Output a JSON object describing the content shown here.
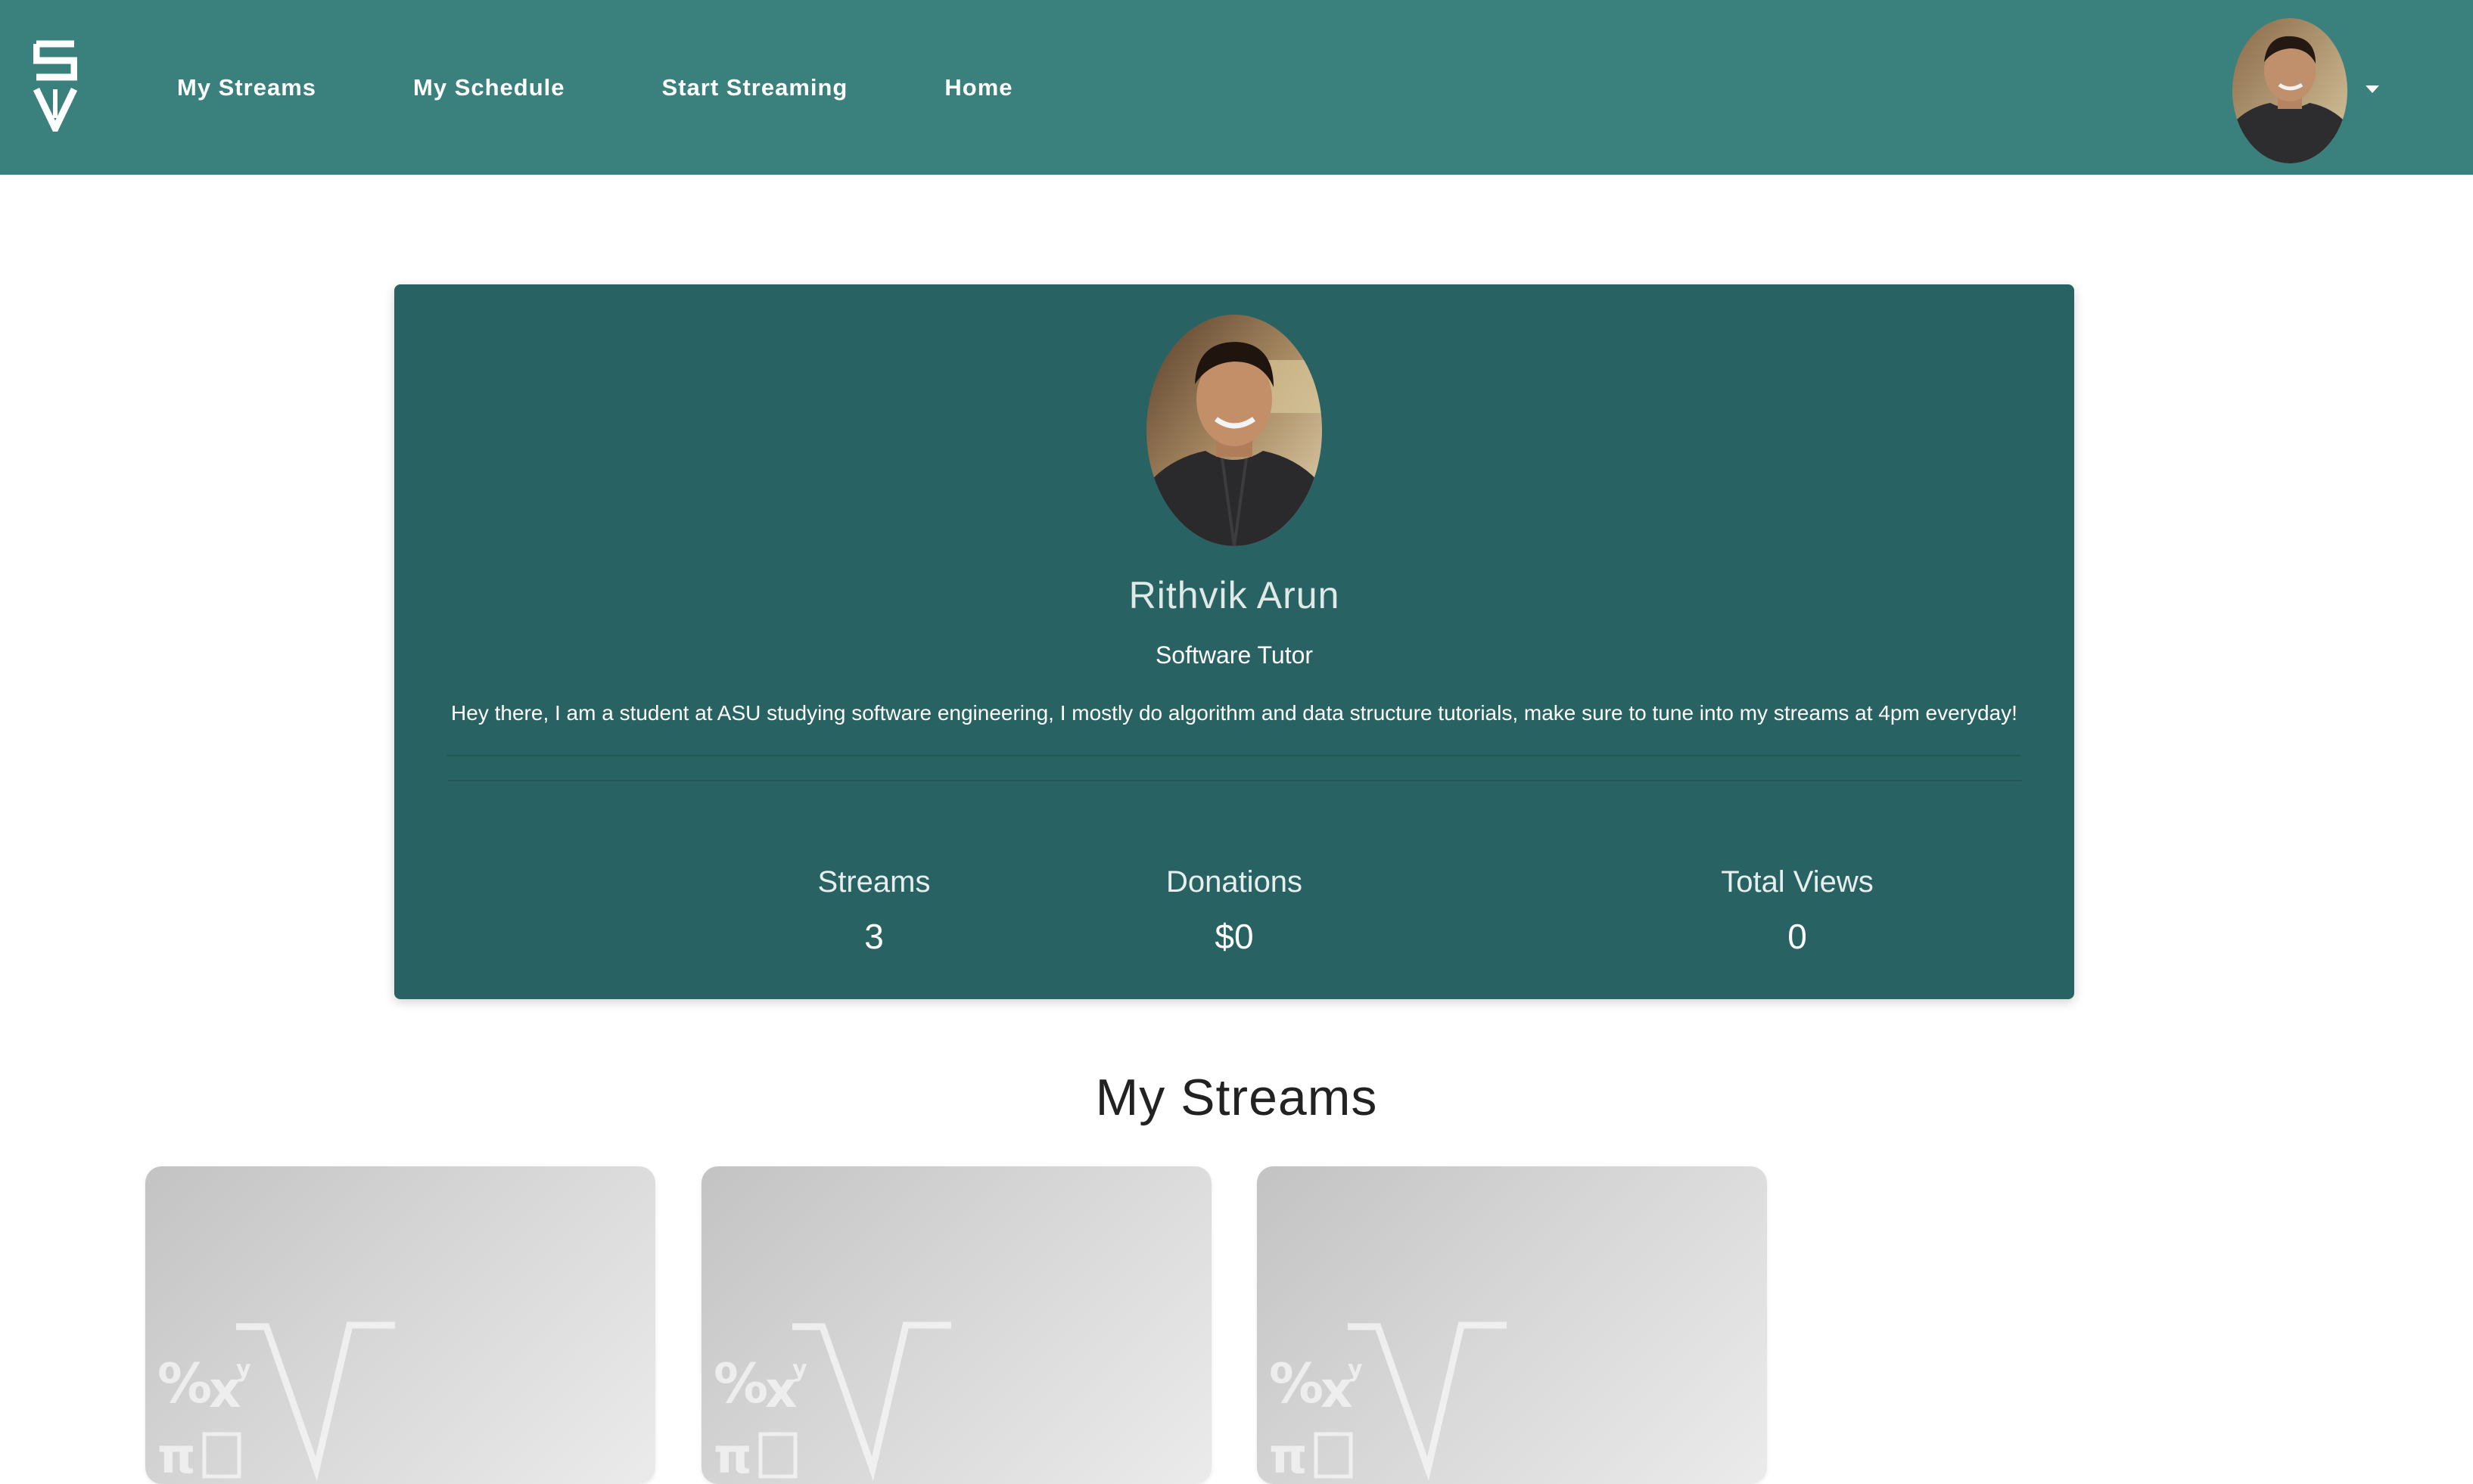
{
  "nav": {
    "logo_icon": "pencil-sv-logo-icon",
    "links": [
      {
        "label": "My Streams"
      },
      {
        "label": "My Schedule"
      },
      {
        "label": "Start Streaming"
      },
      {
        "label": "Home"
      }
    ],
    "avatar_icon": "user-avatar",
    "caret_icon": "caret-down-icon"
  },
  "profile": {
    "name": "Rithvik Arun",
    "title": "Software Tutor",
    "bio": "Hey there, I am a student at ASU studying software engineering, I mostly do algorithm and data structure tutorials, make sure to tune into my streams at 4pm everyday!",
    "stats": [
      {
        "label": "Streams",
        "value": "3"
      },
      {
        "label": "Donations",
        "value": "$0"
      },
      {
        "label": "Total Views",
        "value": "0"
      }
    ]
  },
  "streams_section": {
    "title": "My Streams",
    "cards": [
      {
        "thumbnail_icon": "math-symbols-thumbnail"
      },
      {
        "thumbnail_icon": "math-symbols-thumbnail"
      },
      {
        "thumbnail_icon": "math-symbols-thumbnail"
      }
    ]
  },
  "colors": {
    "nav_bg": "#3a807d",
    "card_bg": "#296262",
    "text_light": "#ffffff"
  }
}
